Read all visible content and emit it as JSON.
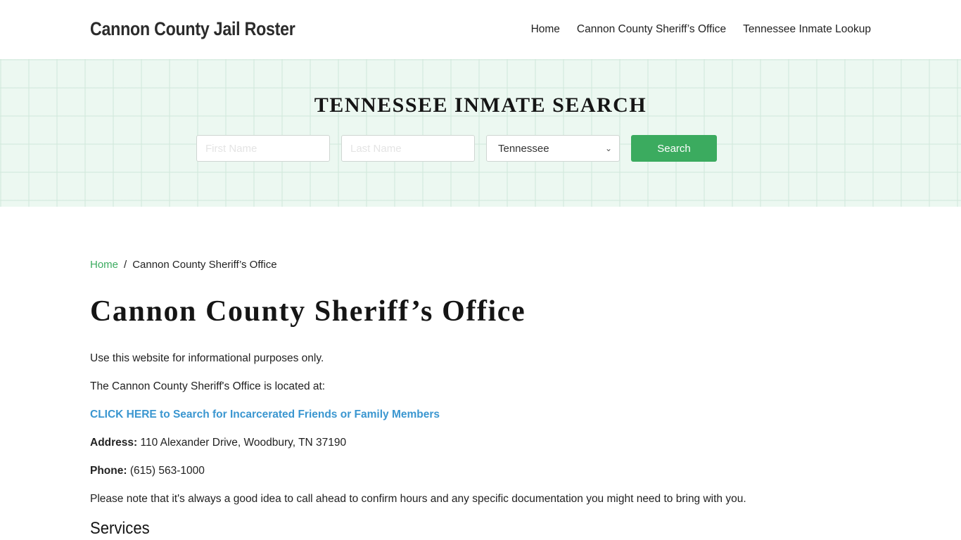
{
  "header": {
    "brand": "Cannon County Jail Roster",
    "nav": [
      {
        "label": "Home"
      },
      {
        "label": "Cannon County Sheriff’s Office"
      },
      {
        "label": "Tennessee Inmate Lookup"
      }
    ]
  },
  "search": {
    "title": "TENNESSEE INMATE SEARCH",
    "first_name_placeholder": "First Name",
    "last_name_placeholder": "Last Name",
    "state_selected": "Tennessee",
    "button_label": "Search"
  },
  "breadcrumb": {
    "home": "Home",
    "separator": "/",
    "current": "Cannon County Sheriff’s Office"
  },
  "main": {
    "title": "Cannon County Sheriff’s Office",
    "intro": "Use this website for informational purposes only.",
    "located": "The Cannon County Sheriff's Office is located at:",
    "cta_link": "CLICK HERE to Search for Incarcerated Friends or Family Members",
    "address_label": "Address:",
    "address_value": " 110 Alexander Drive, Woodbury, TN 37190",
    "phone_label": "Phone:",
    "phone_value": " (615) 563-1000",
    "note": "Please note that it's always a good idea to call ahead to confirm hours and any specific documentation you might need to bring with you.",
    "services_heading": "Services"
  },
  "colors": {
    "accent_green": "#3bab5f",
    "link_blue": "#3a96d0",
    "hero_bg": "#ecf8f1"
  }
}
